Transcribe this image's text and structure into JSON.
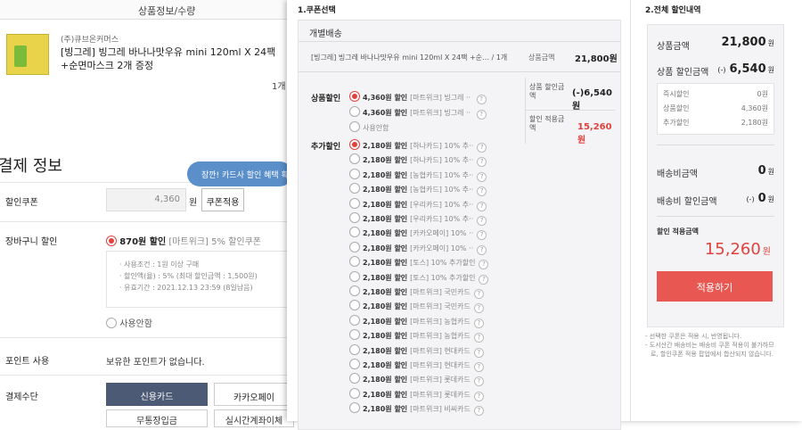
{
  "background_page": {
    "header": "상품정보/수량",
    "product": {
      "seller": "(주)큐브온커머스",
      "name": "[빙그레] 빙그레 바나나맛우유 mini 120ml X 24팩 +순면마스크 2개 증정",
      "qty": "1개"
    },
    "payment_title": "결제 정보",
    "coupon": {
      "label": "할인쿠폰",
      "value": "4,360",
      "unit": "원",
      "apply_label": "쿠폰적용",
      "tooltip": "잠깐! 카드사 할인 혜택 확"
    },
    "cart": {
      "label": "장바구니 할인",
      "option": "870원 할인",
      "option_desc": "[마트위크] 5% 할인쿠폰",
      "conditions": [
        "· 사용조건 : 1원 이상 구매",
        "· 할인액(율) : 5% (최대 할인금액 : 1,500원)",
        "· 유효기간 : 2021.12.13 23:59 (8일남음)"
      ],
      "no_use": "사용안함"
    },
    "points": {
      "label": "포인트 사용",
      "text": "보유한 포인트가 없습니다."
    },
    "pay_method": {
      "label": "결제수단",
      "buttons": [
        "신용카드",
        "카카오페이",
        "무통장입금",
        "실시간계좌이체"
      ]
    }
  },
  "modal": {
    "step1_title": "1.쿠폰선택",
    "step2_title": "2.전체 할인내역",
    "group_title": "개별배송",
    "item": {
      "name": "[빙그레] 빙그레 바나나맛우유 mini 120ml X 24팩 +순… / 1개",
      "price_label": "상품금액",
      "price": "21,800원"
    },
    "side": {
      "discount_label": "상품 할인금액",
      "discount": "(-)6,540원",
      "final_label": "할인 적용금액",
      "final": "15,260원"
    },
    "product_discount": {
      "label": "상품할인",
      "options": [
        {
          "amount": "4,360원 할인",
          "desc": "[마트위크] 빙그레 ·· ",
          "selected": true
        },
        {
          "amount": "4,360원 할인",
          "desc": "[마트위크] 빙그레 ·· ",
          "selected": false
        }
      ],
      "no_use": "사용안함"
    },
    "extra_discount": {
      "label": "추가할인",
      "options": [
        {
          "amount": "2,180원 할인",
          "desc": "[하나카드] 10% 추··",
          "selected": true
        },
        {
          "amount": "2,180원 할인",
          "desc": "[하나카드] 10% 추··",
          "selected": false
        },
        {
          "amount": "2,180원 할인",
          "desc": "[농협카드] 10% 추··",
          "selected": false
        },
        {
          "amount": "2,180원 할인",
          "desc": "[농협카드] 10% 추··",
          "selected": false
        },
        {
          "amount": "2,180원 할인",
          "desc": "[우리카드] 10% 추··",
          "selected": false
        },
        {
          "amount": "2,180원 할인",
          "desc": "[우리카드] 10% 추··",
          "selected": false
        },
        {
          "amount": "2,180원 할인",
          "desc": "[카카오페이] 10% ··",
          "selected": false
        },
        {
          "amount": "2,180원 할인",
          "desc": "[카카오페이] 10% ··",
          "selected": false
        },
        {
          "amount": "2,180원 할인",
          "desc": "[토스] 10% 추가할인",
          "selected": false
        },
        {
          "amount": "2,180원 할인",
          "desc": "[토스] 10% 추가할인",
          "selected": false
        },
        {
          "amount": "2,180원 할인",
          "desc": "[마트위크] 국민카드",
          "selected": false
        },
        {
          "amount": "2,180원 할인",
          "desc": "[마트위크] 국민카드",
          "selected": false
        },
        {
          "amount": "2,180원 할인",
          "desc": "[마트위크] 농협카드",
          "selected": false
        },
        {
          "amount": "2,180원 할인",
          "desc": "[마트위크] 농협카드",
          "selected": false
        },
        {
          "amount": "2,180원 할인",
          "desc": "[마트위크] 현대카드",
          "selected": false
        },
        {
          "amount": "2,180원 할인",
          "desc": "[마트위크] 현대카드",
          "selected": false
        },
        {
          "amount": "2,180원 할인",
          "desc": "[마트위크] 롯데카드",
          "selected": false
        },
        {
          "amount": "2,180원 할인",
          "desc": "[마트위크] 롯데카드",
          "selected": false
        },
        {
          "amount": "2,180원 할인",
          "desc": "[마트위크] 비씨카드",
          "selected": false
        }
      ]
    },
    "summary": {
      "product_amount_label": "상품금액",
      "product_amount": "21,800",
      "unit": "원",
      "discount_label": "상품 할인금액",
      "discount_prefix": "(-)",
      "discount": "6,540",
      "details": [
        {
          "label": "즉시할인",
          "value": "0원"
        },
        {
          "label": "상품할인",
          "value": "4,360원"
        },
        {
          "label": "추가할인",
          "value": "2,180원"
        }
      ],
      "shipping_label": "배송비금액",
      "shipping": "0",
      "shipping_discount_label": "배송비 할인금액",
      "shipping_discount_prefix": "(-)",
      "shipping_discount": "0",
      "final_label": "할인 적용금액",
      "final": "15,260",
      "apply_label": "적용하기"
    },
    "notes": [
      "- 선택한 쿠폰은 적용 시, 반영됩니다.",
      "- 도서산간 배송비는 배송비 쿠폰 적용이 불가하므",
      "로, 할인쿠폰 적용 팝업에서 합산되지 않습니다."
    ]
  }
}
